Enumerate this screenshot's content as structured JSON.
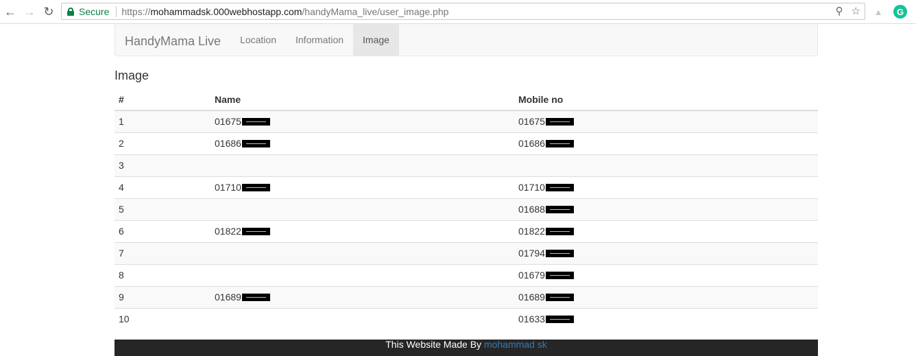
{
  "browser": {
    "secure_label": "Secure",
    "url_scheme": "https://",
    "url_host": "mohammadsk.000webhostapp.com",
    "url_path": "/handyMama_live/user_image.php"
  },
  "navbar": {
    "brand": "HandyMama Live",
    "links": [
      {
        "label": "Location"
      },
      {
        "label": "Information"
      },
      {
        "label": "Image"
      }
    ]
  },
  "main": {
    "title": "Image",
    "table": {
      "headers": [
        "#",
        "Name",
        "Mobile no"
      ],
      "rows": [
        {
          "num": "1",
          "name": "01675",
          "mobile": "01675"
        },
        {
          "num": "2",
          "name": "01686",
          "mobile": "01686"
        },
        {
          "num": "3",
          "name": "",
          "mobile": ""
        },
        {
          "num": "4",
          "name": "01710",
          "mobile": "01710"
        },
        {
          "num": "5",
          "name": "",
          "mobile": "01688"
        },
        {
          "num": "6",
          "name": "01822",
          "mobile": "01822"
        },
        {
          "num": "7",
          "name": "",
          "mobile": "01794"
        },
        {
          "num": "8",
          "name": "",
          "mobile": "01679"
        },
        {
          "num": "9",
          "name": "01689",
          "mobile": "01689"
        },
        {
          "num": "10",
          "name": "",
          "mobile": "01633"
        }
      ]
    }
  },
  "footer": {
    "text": "This Website Made By ",
    "link": "mohammad sk"
  }
}
